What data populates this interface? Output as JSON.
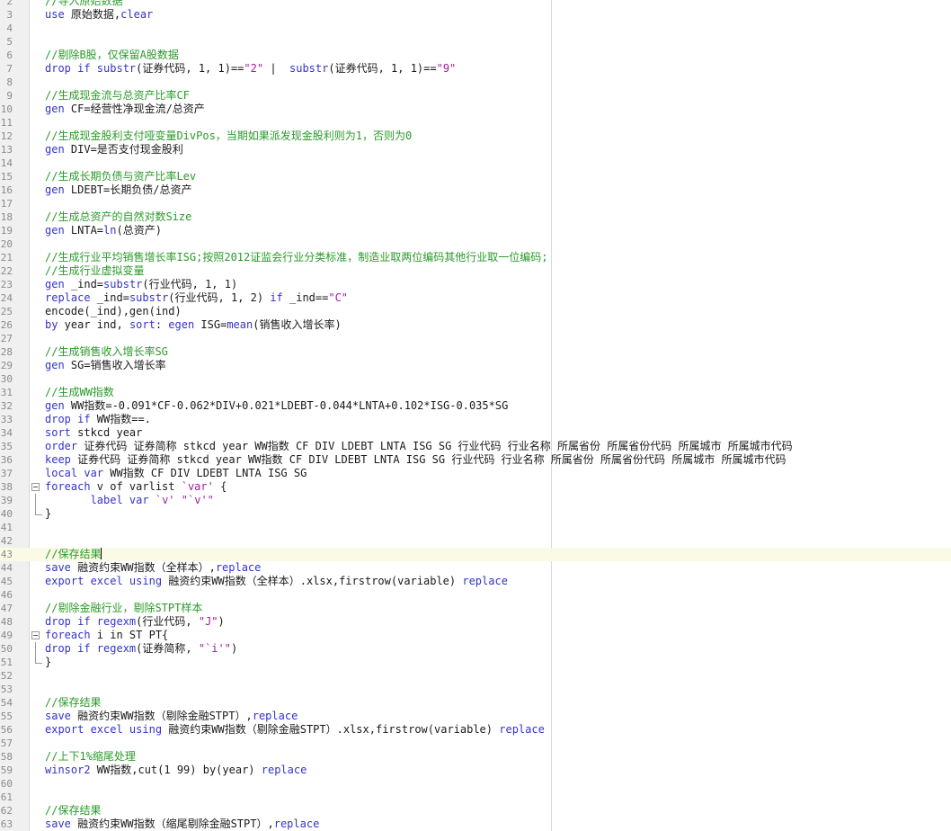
{
  "editor": {
    "lines": [
      {
        "n": "2",
        "parts": [
          {
            "c": "cmt",
            "t": "//导入原始数据"
          }
        ]
      },
      {
        "n": "3",
        "parts": [
          {
            "c": "kw",
            "t": "use"
          },
          {
            "c": "",
            "t": " 原始数据,"
          },
          {
            "c": "kw",
            "t": "clear"
          }
        ]
      },
      {
        "n": "4",
        "parts": []
      },
      {
        "n": "5",
        "parts": []
      },
      {
        "n": "6",
        "parts": [
          {
            "c": "cmt",
            "t": "//剔除B股，仅保留A股数据"
          }
        ]
      },
      {
        "n": "7",
        "parts": [
          {
            "c": "kw",
            "t": "drop if substr"
          },
          {
            "c": "",
            "t": "(证券代码, 1, 1)=="
          },
          {
            "c": "str",
            "t": "\"2\""
          },
          {
            "c": "",
            "t": " |  "
          },
          {
            "c": "kw",
            "t": "substr"
          },
          {
            "c": "",
            "t": "(证券代码, 1, 1)=="
          },
          {
            "c": "str",
            "t": "\"9\""
          }
        ]
      },
      {
        "n": "8",
        "parts": []
      },
      {
        "n": "9",
        "parts": [
          {
            "c": "cmt",
            "t": "//生成现金流与总资产比率CF"
          }
        ]
      },
      {
        "n": "10",
        "parts": [
          {
            "c": "kw",
            "t": "gen"
          },
          {
            "c": "",
            "t": " CF=经营性净现金流/总资产"
          }
        ]
      },
      {
        "n": "11",
        "parts": []
      },
      {
        "n": "12",
        "parts": [
          {
            "c": "cmt",
            "t": "//生成现金股利支付哑变量DivPos，当期如果派发现金股利则为1，否则为0"
          }
        ]
      },
      {
        "n": "13",
        "parts": [
          {
            "c": "kw",
            "t": "gen"
          },
          {
            "c": "",
            "t": " DIV=是否支付现金股利"
          }
        ]
      },
      {
        "n": "14",
        "parts": []
      },
      {
        "n": "15",
        "parts": [
          {
            "c": "cmt",
            "t": "//生成长期负债与资产比率Lev"
          }
        ]
      },
      {
        "n": "16",
        "parts": [
          {
            "c": "kw",
            "t": "gen"
          },
          {
            "c": "",
            "t": " LDEBT=长期负债/总资产"
          }
        ]
      },
      {
        "n": "17",
        "parts": []
      },
      {
        "n": "18",
        "parts": [
          {
            "c": "cmt",
            "t": "//生成总资产的自然对数Size"
          }
        ]
      },
      {
        "n": "19",
        "parts": [
          {
            "c": "kw",
            "t": "gen"
          },
          {
            "c": "",
            "t": " LNTA="
          },
          {
            "c": "kw",
            "t": "ln"
          },
          {
            "c": "",
            "t": "(总资产)"
          }
        ]
      },
      {
        "n": "20",
        "parts": []
      },
      {
        "n": "21",
        "parts": [
          {
            "c": "cmt",
            "t": "//生成行业平均销售增长率ISG;按照2012证监会行业分类标准，制造业取两位编码其他行业取一位编码;"
          }
        ]
      },
      {
        "n": "22",
        "parts": [
          {
            "c": "cmt",
            "t": "//生成行业虚拟变量"
          }
        ]
      },
      {
        "n": "23",
        "parts": [
          {
            "c": "kw",
            "t": "gen"
          },
          {
            "c": "",
            "t": " _ind="
          },
          {
            "c": "kw",
            "t": "substr"
          },
          {
            "c": "",
            "t": "(行业代码, 1, 1)"
          }
        ]
      },
      {
        "n": "24",
        "parts": [
          {
            "c": "kw",
            "t": "replace"
          },
          {
            "c": "",
            "t": " _ind="
          },
          {
            "c": "kw",
            "t": "substr"
          },
          {
            "c": "",
            "t": "(行业代码, 1, 2) "
          },
          {
            "c": "kw",
            "t": "if"
          },
          {
            "c": "",
            "t": " _ind=="
          },
          {
            "c": "str",
            "t": "\"C\""
          }
        ]
      },
      {
        "n": "25",
        "parts": [
          {
            "c": "",
            "t": "encode(_ind),gen(ind)"
          }
        ]
      },
      {
        "n": "26",
        "parts": [
          {
            "c": "kw",
            "t": "by"
          },
          {
            "c": "",
            "t": " year ind, "
          },
          {
            "c": "kw",
            "t": "sort"
          },
          {
            "c": "",
            "t": ": "
          },
          {
            "c": "kw",
            "t": "egen"
          },
          {
            "c": "",
            "t": " ISG="
          },
          {
            "c": "kw",
            "t": "mean"
          },
          {
            "c": "",
            "t": "(销售收入增长率)"
          }
        ]
      },
      {
        "n": "27",
        "parts": []
      },
      {
        "n": "28",
        "parts": [
          {
            "c": "cmt",
            "t": "//生成销售收入增长率SG"
          }
        ]
      },
      {
        "n": "29",
        "parts": [
          {
            "c": "kw",
            "t": "gen"
          },
          {
            "c": "",
            "t": " SG=销售收入增长率"
          }
        ]
      },
      {
        "n": "30",
        "parts": []
      },
      {
        "n": "31",
        "parts": [
          {
            "c": "cmt",
            "t": "//生成WW指数"
          }
        ]
      },
      {
        "n": "32",
        "parts": [
          {
            "c": "kw",
            "t": "gen"
          },
          {
            "c": "",
            "t": " WW指数=-0.091*CF-0.062*DIV+0.021*LDEBT-0.044*LNTA+0.102*ISG-0.035*SG"
          }
        ]
      },
      {
        "n": "33",
        "parts": [
          {
            "c": "kw",
            "t": "drop if"
          },
          {
            "c": "",
            "t": " WW指数==."
          }
        ]
      },
      {
        "n": "34",
        "parts": [
          {
            "c": "kw",
            "t": "sort"
          },
          {
            "c": "",
            "t": " stkcd year"
          }
        ]
      },
      {
        "n": "35",
        "parts": [
          {
            "c": "kw",
            "t": "order"
          },
          {
            "c": "",
            "t": " 证券代码 证券简称 stkcd year WW指数 CF DIV LDEBT LNTA ISG SG 行业代码 行业名称 所属省份 所属省份代码 所属城市 所属城市代码"
          }
        ]
      },
      {
        "n": "36",
        "parts": [
          {
            "c": "kw",
            "t": "keep"
          },
          {
            "c": "",
            "t": " 证券代码 证券简称 stkcd year WW指数 CF DIV LDEBT LNTA ISG SG 行业代码 行业名称 所属省份 所属省份代码 所属城市 所属城市代码"
          }
        ]
      },
      {
        "n": "37",
        "parts": [
          {
            "c": "kw",
            "t": "local var"
          },
          {
            "c": "",
            "t": " WW指数 CF DIV LDEBT LNTA ISG SG"
          }
        ]
      },
      {
        "n": "38",
        "fold": "open",
        "parts": [
          {
            "c": "kw",
            "t": "foreach"
          },
          {
            "c": "",
            "t": " v of varlist "
          },
          {
            "c": "str",
            "t": "`var'"
          },
          {
            "c": "",
            "t": " {"
          }
        ]
      },
      {
        "n": "39",
        "fold": "mid",
        "parts": [
          {
            "c": "",
            "t": "       "
          },
          {
            "c": "kw",
            "t": "label var"
          },
          {
            "c": "",
            "t": " "
          },
          {
            "c": "str",
            "t": "`v'"
          },
          {
            "c": "",
            "t": " "
          },
          {
            "c": "str",
            "t": "\"`v'\""
          }
        ]
      },
      {
        "n": "40",
        "fold": "end",
        "parts": [
          {
            "c": "",
            "t": "}"
          }
        ]
      },
      {
        "n": "41",
        "parts": []
      },
      {
        "n": "42",
        "parts": []
      },
      {
        "n": "43",
        "current": true,
        "parts": [
          {
            "c": "cmt",
            "t": "//保存结果"
          }
        ]
      },
      {
        "n": "44",
        "parts": [
          {
            "c": "kw",
            "t": "save"
          },
          {
            "c": "",
            "t": " 融资约束WW指数（全样本）,"
          },
          {
            "c": "kw",
            "t": "replace"
          }
        ]
      },
      {
        "n": "45",
        "parts": [
          {
            "c": "kw",
            "t": "export excel using"
          },
          {
            "c": "",
            "t": " 融资约束WW指数（全样本）.xlsx,firstrow(variable) "
          },
          {
            "c": "kw",
            "t": "replace"
          }
        ]
      },
      {
        "n": "46",
        "parts": []
      },
      {
        "n": "47",
        "parts": [
          {
            "c": "cmt",
            "t": "//剔除金融行业，剔除STPT样本"
          }
        ]
      },
      {
        "n": "48",
        "parts": [
          {
            "c": "kw",
            "t": "drop if regexm"
          },
          {
            "c": "",
            "t": "(行业代码, "
          },
          {
            "c": "str",
            "t": "\"J\""
          },
          {
            "c": "",
            "t": ")"
          }
        ]
      },
      {
        "n": "49",
        "fold": "open",
        "parts": [
          {
            "c": "kw",
            "t": "foreach"
          },
          {
            "c": "",
            "t": " i in ST PT{"
          }
        ]
      },
      {
        "n": "50",
        "fold": "mid",
        "parts": [
          {
            "c": "kw",
            "t": "drop if regexm"
          },
          {
            "c": "",
            "t": "(证券简称, "
          },
          {
            "c": "str",
            "t": "\"`i'\""
          },
          {
            "c": "",
            "t": ")"
          }
        ]
      },
      {
        "n": "51",
        "fold": "end",
        "parts": [
          {
            "c": "",
            "t": "}"
          }
        ]
      },
      {
        "n": "52",
        "parts": []
      },
      {
        "n": "53",
        "parts": []
      },
      {
        "n": "54",
        "parts": [
          {
            "c": "cmt",
            "t": "//保存结果"
          }
        ]
      },
      {
        "n": "55",
        "parts": [
          {
            "c": "kw",
            "t": "save"
          },
          {
            "c": "",
            "t": " 融资约束WW指数（剔除金融STPT）,"
          },
          {
            "c": "kw",
            "t": "replace"
          }
        ]
      },
      {
        "n": "56",
        "parts": [
          {
            "c": "kw",
            "t": "export excel using"
          },
          {
            "c": "",
            "t": " 融资约束WW指数（剔除金融STPT）.xlsx,firstrow(variable) "
          },
          {
            "c": "kw",
            "t": "replace"
          }
        ]
      },
      {
        "n": "57",
        "parts": []
      },
      {
        "n": "58",
        "parts": [
          {
            "c": "cmt",
            "t": "//上下1%缩尾处理"
          }
        ]
      },
      {
        "n": "59",
        "parts": [
          {
            "c": "kw",
            "t": "winsor2"
          },
          {
            "c": "",
            "t": " WW指数,cut(1 99) by(year) "
          },
          {
            "c": "kw",
            "t": "replace"
          }
        ]
      },
      {
        "n": "60",
        "parts": []
      },
      {
        "n": "61",
        "parts": []
      },
      {
        "n": "62",
        "parts": [
          {
            "c": "cmt",
            "t": "//保存结果"
          }
        ]
      },
      {
        "n": "63",
        "parts": [
          {
            "c": "kw",
            "t": "save"
          },
          {
            "c": "",
            "t": " 融资约束WW指数（缩尾剔除金融STPT）,"
          },
          {
            "c": "kw",
            "t": "replace"
          }
        ]
      }
    ]
  }
}
